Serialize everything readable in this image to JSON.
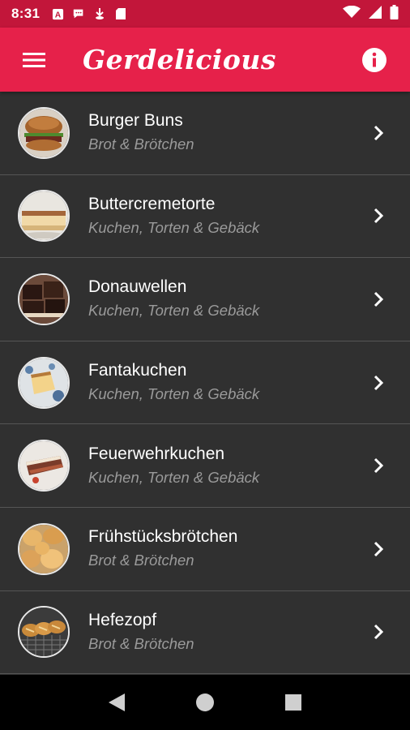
{
  "status_bar": {
    "time": "8:31",
    "notification_icons": [
      "text-icon",
      "chat-icon",
      "download-icon",
      "sd-card-icon"
    ],
    "system_icons": [
      "wifi-icon",
      "signal-icon",
      "battery-icon"
    ]
  },
  "app_bar": {
    "title": "Gerdelicious",
    "menu_icon": "menu-icon",
    "info_icon": "info-icon",
    "color": "#e6214a",
    "status_color": "#c2163a"
  },
  "recipes": [
    {
      "title": "Burger Buns",
      "category": "Brot & Brötchen",
      "thumb": "burger"
    },
    {
      "title": "Buttercremetorte",
      "category": "Kuchen, Torten & Gebäck",
      "thumb": "cake-slice"
    },
    {
      "title": "Donauwellen",
      "category": "Kuchen, Torten & Gebäck",
      "thumb": "chocolate-squares"
    },
    {
      "title": "Fantakuchen",
      "category": "Kuchen, Torten & Gebäck",
      "thumb": "sponge-slice"
    },
    {
      "title": "Feuerwehrkuchen",
      "category": "Kuchen, Torten & Gebäck",
      "thumb": "layer-slice"
    },
    {
      "title": "Frühstücksbrötchen",
      "category": "Brot & Brötchen",
      "thumb": "rolls"
    },
    {
      "title": "Hefezopf",
      "category": "Brot & Brötchen",
      "thumb": "braid"
    }
  ],
  "nav_bar": {
    "icons": [
      "back-icon",
      "home-icon",
      "recents-icon"
    ]
  }
}
